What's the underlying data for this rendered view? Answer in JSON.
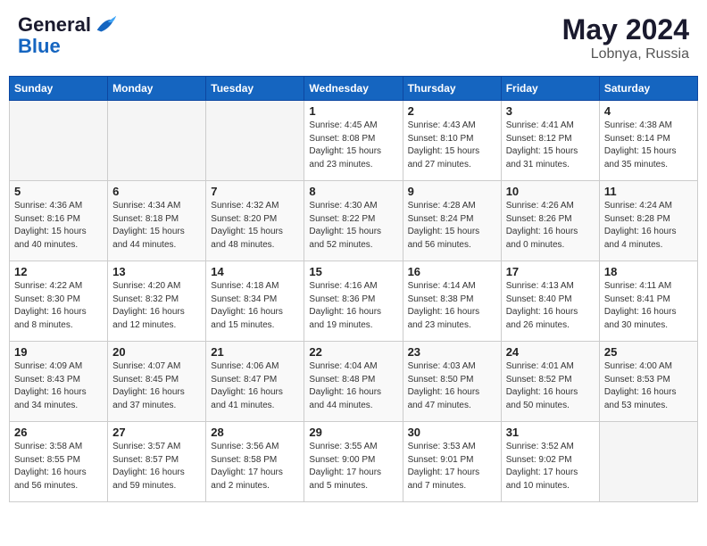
{
  "header": {
    "logo_line1": "General",
    "logo_line2": "Blue",
    "month_year": "May 2024",
    "location": "Lobnya, Russia"
  },
  "weekdays": [
    "Sunday",
    "Monday",
    "Tuesday",
    "Wednesday",
    "Thursday",
    "Friday",
    "Saturday"
  ],
  "weeks": [
    [
      {
        "day": "",
        "info": ""
      },
      {
        "day": "",
        "info": ""
      },
      {
        "day": "",
        "info": ""
      },
      {
        "day": "1",
        "info": "Sunrise: 4:45 AM\nSunset: 8:08 PM\nDaylight: 15 hours\nand 23 minutes."
      },
      {
        "day": "2",
        "info": "Sunrise: 4:43 AM\nSunset: 8:10 PM\nDaylight: 15 hours\nand 27 minutes."
      },
      {
        "day": "3",
        "info": "Sunrise: 4:41 AM\nSunset: 8:12 PM\nDaylight: 15 hours\nand 31 minutes."
      },
      {
        "day": "4",
        "info": "Sunrise: 4:38 AM\nSunset: 8:14 PM\nDaylight: 15 hours\nand 35 minutes."
      }
    ],
    [
      {
        "day": "5",
        "info": "Sunrise: 4:36 AM\nSunset: 8:16 PM\nDaylight: 15 hours\nand 40 minutes."
      },
      {
        "day": "6",
        "info": "Sunrise: 4:34 AM\nSunset: 8:18 PM\nDaylight: 15 hours\nand 44 minutes."
      },
      {
        "day": "7",
        "info": "Sunrise: 4:32 AM\nSunset: 8:20 PM\nDaylight: 15 hours\nand 48 minutes."
      },
      {
        "day": "8",
        "info": "Sunrise: 4:30 AM\nSunset: 8:22 PM\nDaylight: 15 hours\nand 52 minutes."
      },
      {
        "day": "9",
        "info": "Sunrise: 4:28 AM\nSunset: 8:24 PM\nDaylight: 15 hours\nand 56 minutes."
      },
      {
        "day": "10",
        "info": "Sunrise: 4:26 AM\nSunset: 8:26 PM\nDaylight: 16 hours\nand 0 minutes."
      },
      {
        "day": "11",
        "info": "Sunrise: 4:24 AM\nSunset: 8:28 PM\nDaylight: 16 hours\nand 4 minutes."
      }
    ],
    [
      {
        "day": "12",
        "info": "Sunrise: 4:22 AM\nSunset: 8:30 PM\nDaylight: 16 hours\nand 8 minutes."
      },
      {
        "day": "13",
        "info": "Sunrise: 4:20 AM\nSunset: 8:32 PM\nDaylight: 16 hours\nand 12 minutes."
      },
      {
        "day": "14",
        "info": "Sunrise: 4:18 AM\nSunset: 8:34 PM\nDaylight: 16 hours\nand 15 minutes."
      },
      {
        "day": "15",
        "info": "Sunrise: 4:16 AM\nSunset: 8:36 PM\nDaylight: 16 hours\nand 19 minutes."
      },
      {
        "day": "16",
        "info": "Sunrise: 4:14 AM\nSunset: 8:38 PM\nDaylight: 16 hours\nand 23 minutes."
      },
      {
        "day": "17",
        "info": "Sunrise: 4:13 AM\nSunset: 8:40 PM\nDaylight: 16 hours\nand 26 minutes."
      },
      {
        "day": "18",
        "info": "Sunrise: 4:11 AM\nSunset: 8:41 PM\nDaylight: 16 hours\nand 30 minutes."
      }
    ],
    [
      {
        "day": "19",
        "info": "Sunrise: 4:09 AM\nSunset: 8:43 PM\nDaylight: 16 hours\nand 34 minutes."
      },
      {
        "day": "20",
        "info": "Sunrise: 4:07 AM\nSunset: 8:45 PM\nDaylight: 16 hours\nand 37 minutes."
      },
      {
        "day": "21",
        "info": "Sunrise: 4:06 AM\nSunset: 8:47 PM\nDaylight: 16 hours\nand 41 minutes."
      },
      {
        "day": "22",
        "info": "Sunrise: 4:04 AM\nSunset: 8:48 PM\nDaylight: 16 hours\nand 44 minutes."
      },
      {
        "day": "23",
        "info": "Sunrise: 4:03 AM\nSunset: 8:50 PM\nDaylight: 16 hours\nand 47 minutes."
      },
      {
        "day": "24",
        "info": "Sunrise: 4:01 AM\nSunset: 8:52 PM\nDaylight: 16 hours\nand 50 minutes."
      },
      {
        "day": "25",
        "info": "Sunrise: 4:00 AM\nSunset: 8:53 PM\nDaylight: 16 hours\nand 53 minutes."
      }
    ],
    [
      {
        "day": "26",
        "info": "Sunrise: 3:58 AM\nSunset: 8:55 PM\nDaylight: 16 hours\nand 56 minutes."
      },
      {
        "day": "27",
        "info": "Sunrise: 3:57 AM\nSunset: 8:57 PM\nDaylight: 16 hours\nand 59 minutes."
      },
      {
        "day": "28",
        "info": "Sunrise: 3:56 AM\nSunset: 8:58 PM\nDaylight: 17 hours\nand 2 minutes."
      },
      {
        "day": "29",
        "info": "Sunrise: 3:55 AM\nSunset: 9:00 PM\nDaylight: 17 hours\nand 5 minutes."
      },
      {
        "day": "30",
        "info": "Sunrise: 3:53 AM\nSunset: 9:01 PM\nDaylight: 17 hours\nand 7 minutes."
      },
      {
        "day": "31",
        "info": "Sunrise: 3:52 AM\nSunset: 9:02 PM\nDaylight: 17 hours\nand 10 minutes."
      },
      {
        "day": "",
        "info": ""
      }
    ]
  ]
}
